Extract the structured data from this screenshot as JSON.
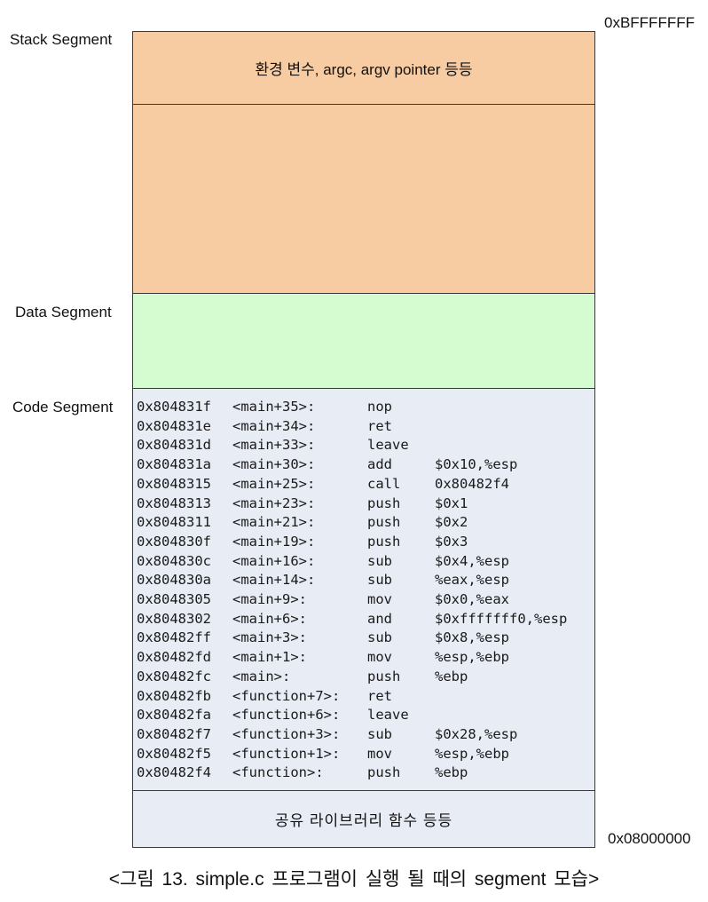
{
  "labels": {
    "stack_segment": "Stack Segment",
    "data_segment": "Data Segment",
    "code_segment": "Code Segment",
    "addr_top": "0xBFFFFFFF",
    "addr_bottom": "0x08000000"
  },
  "stack_top_text": "환경 변수, argc, argv pointer 등등",
  "library_text": "공유 라이브러리 함수 등등",
  "colors": {
    "stack": "#f7cca2",
    "data": "#d5fbd0",
    "code": "#e7ecf5"
  },
  "code_lines": [
    {
      "addr": "0x804831f",
      "sym": "<main+35>:",
      "op": "nop",
      "args": ""
    },
    {
      "addr": "0x804831e",
      "sym": "<main+34>:",
      "op": "ret",
      "args": ""
    },
    {
      "addr": "0x804831d",
      "sym": "<main+33>:",
      "op": "leave",
      "args": ""
    },
    {
      "addr": "0x804831a",
      "sym": "<main+30>:",
      "op": "add",
      "args": "$0x10,%esp"
    },
    {
      "addr": "0x8048315",
      "sym": "<main+25>:",
      "op": "call",
      "args": "0x80482f4"
    },
    {
      "addr": "0x8048313",
      "sym": "<main+23>:",
      "op": "push",
      "args": "$0x1"
    },
    {
      "addr": "0x8048311",
      "sym": "<main+21>:",
      "op": "push",
      "args": "$0x2"
    },
    {
      "addr": "0x804830f",
      "sym": "<main+19>:",
      "op": "push",
      "args": "$0x3"
    },
    {
      "addr": "0x804830c",
      "sym": "<main+16>:",
      "op": "sub",
      "args": "$0x4,%esp"
    },
    {
      "addr": "0x804830a",
      "sym": "<main+14>:",
      "op": "sub",
      "args": "%eax,%esp"
    },
    {
      "addr": "0x8048305",
      "sym": "<main+9>:",
      "op": "mov",
      "args": "$0x0,%eax"
    },
    {
      "addr": "0x8048302",
      "sym": "<main+6>:",
      "op": "and",
      "args": "$0xfffffff0,%esp"
    },
    {
      "addr": "0x80482ff",
      "sym": "<main+3>:",
      "op": "sub",
      "args": "$0x8,%esp"
    },
    {
      "addr": "0x80482fd",
      "sym": "<main+1>:",
      "op": "mov",
      "args": "%esp,%ebp"
    },
    {
      "addr": "0x80482fc",
      "sym": "<main>:",
      "op": "push",
      "args": "%ebp"
    },
    {
      "addr": "0x80482fb",
      "sym": "<function+7>:",
      "op": "ret",
      "args": ""
    },
    {
      "addr": "0x80482fa",
      "sym": "<function+6>:",
      "op": "leave",
      "args": ""
    },
    {
      "addr": "0x80482f7",
      "sym": "<function+3>:",
      "op": "sub",
      "args": "$0x28,%esp"
    },
    {
      "addr": "0x80482f5",
      "sym": "<function+1>:",
      "op": "mov",
      "args": "%esp,%ebp"
    },
    {
      "addr": "0x80482f4",
      "sym": "<function>:",
      "op": "push",
      "args": "%ebp"
    }
  ],
  "caption": "<그림 13. simple.c 프로그램이 실행 될 때의 segment 모습>"
}
